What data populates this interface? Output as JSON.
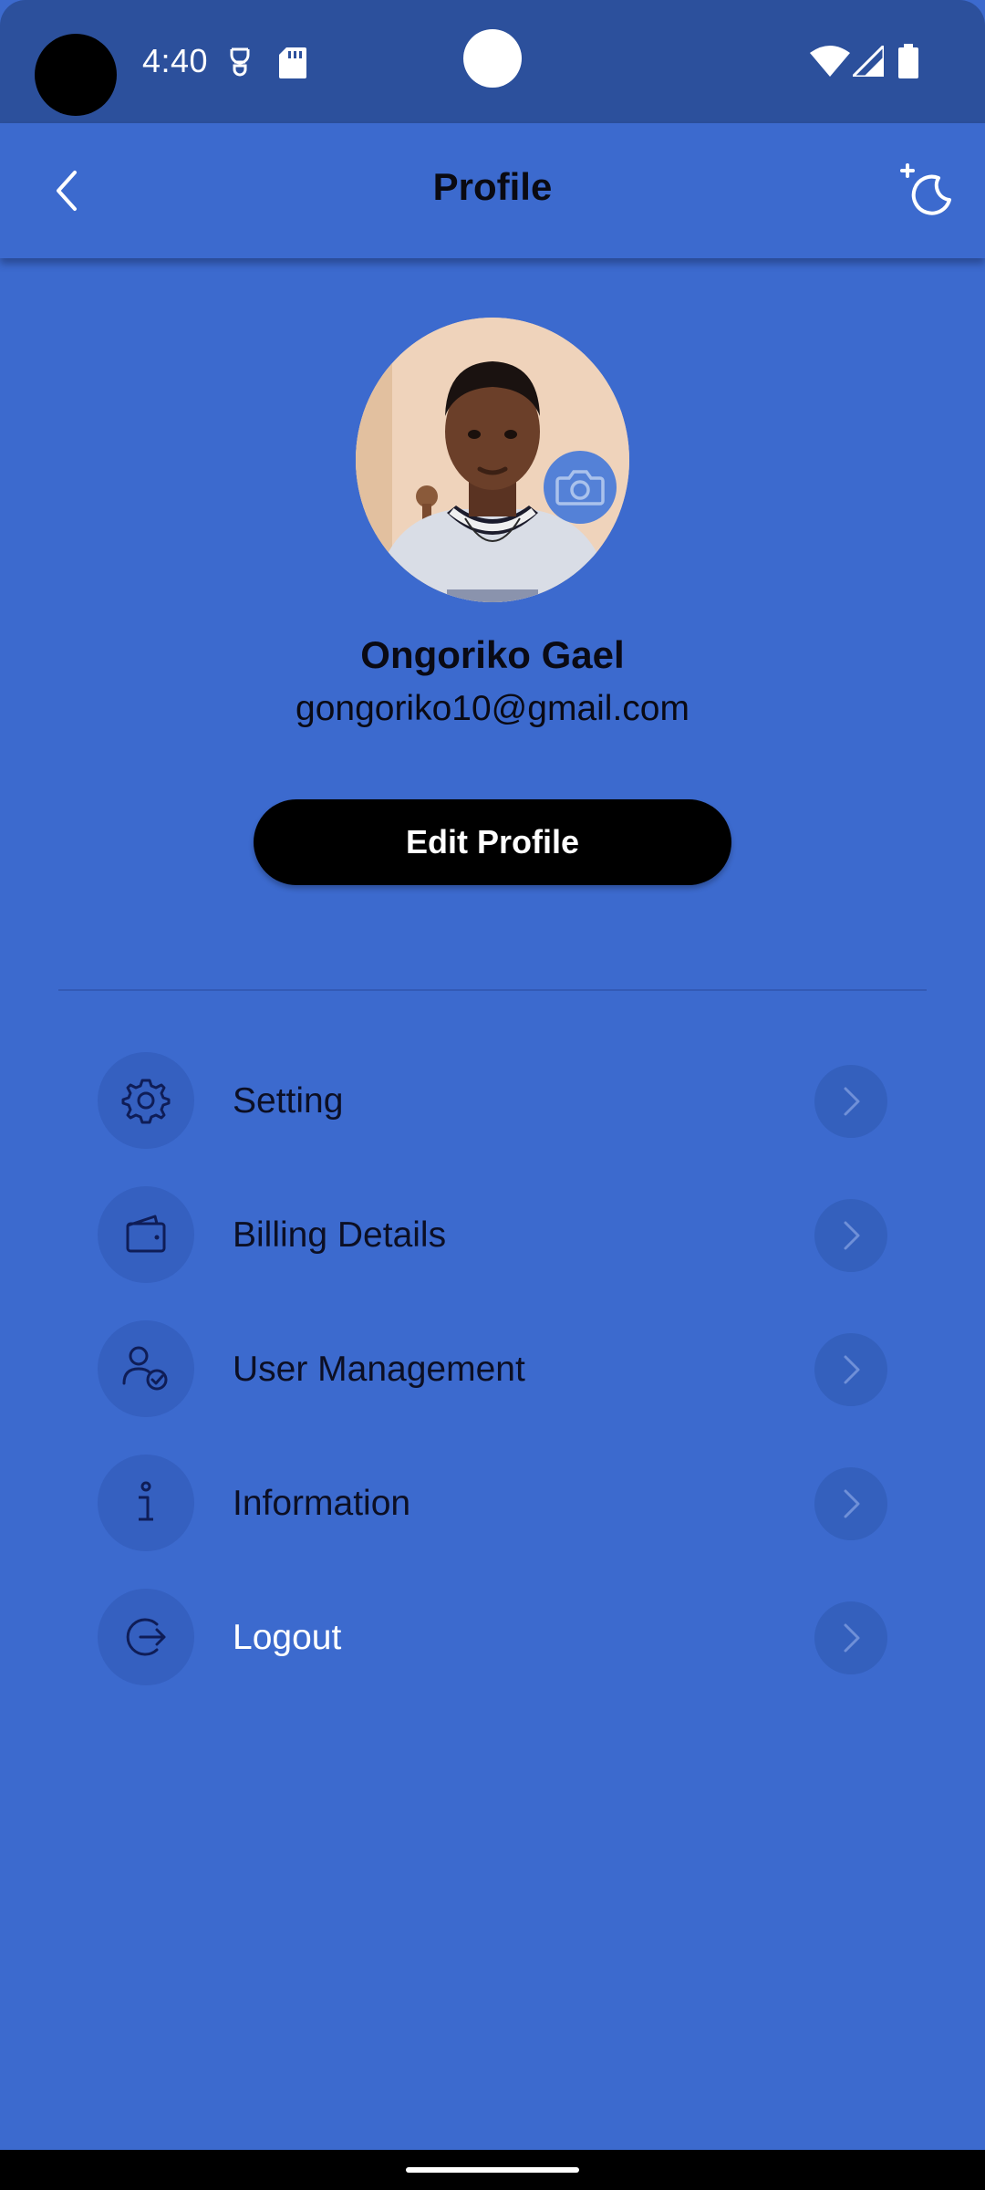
{
  "status_bar": {
    "time": "4:40"
  },
  "app_bar": {
    "title": "Profile",
    "back_icon": "chevron-left-icon",
    "theme_icon": "moon-sparkle-icon"
  },
  "profile": {
    "name": "Ongoriko Gael",
    "email": "gongoriko10@gmail.com",
    "edit_label": "Edit Profile"
  },
  "menu": {
    "items": [
      {
        "label": "Setting",
        "icon": "gear-icon"
      },
      {
        "label": "Billing Details",
        "icon": "wallet-icon"
      },
      {
        "label": "User Management",
        "icon": "user-check-icon"
      },
      {
        "label": "Information",
        "icon": "info-icon"
      },
      {
        "label": "Logout",
        "icon": "logout-icon"
      }
    ]
  },
  "colors": {
    "background": "#3c6ace",
    "status_bar": "#2c509c",
    "icon_circle": "#3560c0",
    "button": "#000000"
  }
}
